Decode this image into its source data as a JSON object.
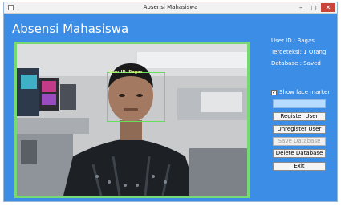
{
  "window": {
    "title": "Absensi Mahasiswa",
    "controls": {
      "minimize": "–",
      "maximize": "□",
      "close": "✕"
    }
  },
  "header": {
    "title": "Absensi Mahasiswa"
  },
  "video": {
    "face_label": "User ID: Bagas",
    "accent_color": "#78d872"
  },
  "info": {
    "user_id": "User ID  : Bagas",
    "terdeteksi": "Terdeteksi: 1 Orang",
    "database": "Database  : Saved"
  },
  "controls": {
    "show_face_marker": "Show face marker",
    "show_face_marker_checked": true,
    "name_input_value": "",
    "buttons": [
      {
        "label": "Register User",
        "enabled": true
      },
      {
        "label": "Unregister User",
        "enabled": true
      },
      {
        "label": "Save Database",
        "enabled": false
      },
      {
        "label": "Delete Database",
        "enabled": true
      },
      {
        "label": "Exit",
        "enabled": true
      }
    ]
  },
  "colors": {
    "window_bg": "#3b8de6",
    "frame_border": "#78d872",
    "close_button": "#c7453b"
  }
}
